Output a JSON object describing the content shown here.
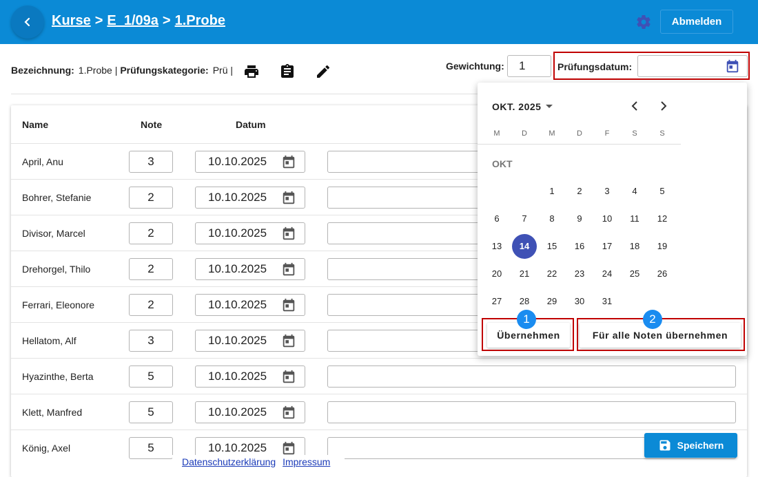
{
  "header": {
    "breadcrumb": [
      "Kurse",
      "E_1/09a",
      "1.Probe"
    ],
    "separator": ">",
    "logout_label": "Abmelden"
  },
  "info": {
    "bezeichnung_label": "Bezeichnung:",
    "bezeichnung_value": "1.Probe |",
    "kategorie_label": "Prüfungskategorie:",
    "kategorie_value": "Prü |",
    "weight_label": "Gewichtung:",
    "weight_value": "1",
    "date_label": "Prüfungsdatum:"
  },
  "table": {
    "headers": [
      "Name",
      "Note",
      "Datum"
    ],
    "rows": [
      {
        "name": "April, Anu",
        "grade": "3",
        "date": "10.10.2025"
      },
      {
        "name": "Bohrer, Stefanie",
        "grade": "2",
        "date": "10.10.2025"
      },
      {
        "name": "Divisor, Marcel",
        "grade": "2",
        "date": "10.10.2025"
      },
      {
        "name": "Drehorgel, Thilo",
        "grade": "2",
        "date": "10.10.2025"
      },
      {
        "name": "Ferrari, Eleonore",
        "grade": "2",
        "date": "10.10.2025"
      },
      {
        "name": "Hellatom, Alf",
        "grade": "3",
        "date": "10.10.2025"
      },
      {
        "name": "Hyazinthe, Berta",
        "grade": "5",
        "date": "10.10.2025"
      },
      {
        "name": "Klett, Manfred",
        "grade": "5",
        "date": "10.10.2025"
      },
      {
        "name": "König, Axel",
        "grade": "5",
        "date": "10.10.2025"
      }
    ]
  },
  "picker": {
    "month_label": "OKT. 2025",
    "weekdays": [
      "M",
      "D",
      "M",
      "D",
      "F",
      "S",
      "S"
    ],
    "month_short": "OKT",
    "days": [
      "1",
      "2",
      "3",
      "4",
      "5",
      "6",
      "7",
      "8",
      "9",
      "10",
      "11",
      "12",
      "13",
      "14",
      "15",
      "16",
      "17",
      "18",
      "19",
      "20",
      "21",
      "22",
      "23",
      "24",
      "25",
      "26",
      "27",
      "28",
      "29",
      "30",
      "31"
    ],
    "first_weekday_index": 2,
    "selected_day": "14",
    "apply_label": "Übernehmen",
    "apply_all_label": "Für alle Noten übernehmen",
    "badge1": "1",
    "badge2": "2"
  },
  "footer": {
    "privacy": "Datenschutzerklärung",
    "imprint": "Impressum",
    "save_label": "Speichern"
  },
  "colors": {
    "header_bg": "#0b8ad6",
    "selected_day": "#3f51b5",
    "highlight_border": "#c00000",
    "badge": "#1a8cf0",
    "gear": "#3f51b5"
  }
}
